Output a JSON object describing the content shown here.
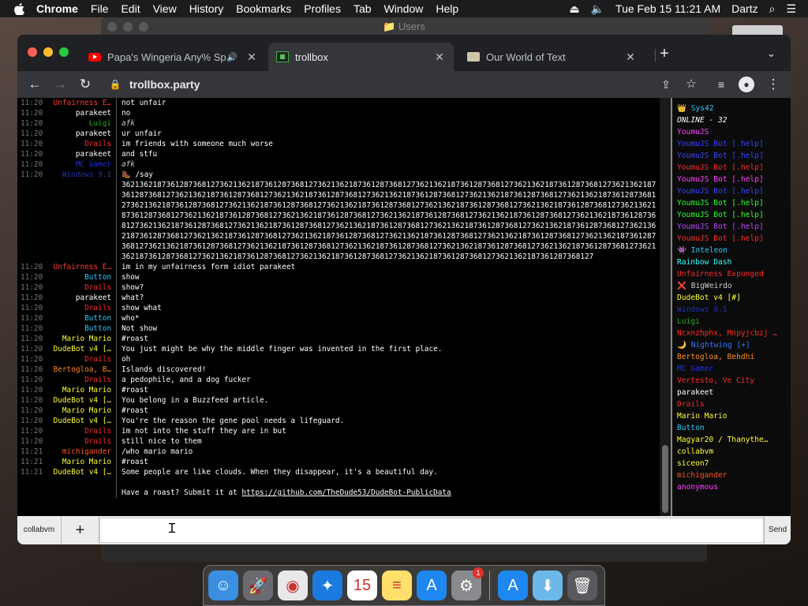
{
  "menubar": {
    "app": "Chrome",
    "items": [
      "File",
      "Edit",
      "View",
      "History",
      "Bookmarks",
      "Profiles",
      "Tab",
      "Window",
      "Help"
    ],
    "datetime": "Tue Feb 15  11:21 AM",
    "user": "Dartz"
  },
  "background_window": {
    "title": "Users"
  },
  "tabs": [
    {
      "title": "Papa's Wingeria Any% Spe",
      "icon": "youtube-icon"
    },
    {
      "title": "trollbox",
      "icon": "trollbox-icon"
    },
    {
      "title": "Our World of Text",
      "icon": "owot-icon"
    }
  ],
  "address": "trollbox.party",
  "chat": [
    {
      "t": "11:20",
      "n": "Unfairness E…",
      "nc": "#ff3b30",
      "m": "not unfair",
      "mc": "#ffffff"
    },
    {
      "t": "11:20",
      "n": "parakeet",
      "nc": "#ffffff",
      "m": "no",
      "mc": "#ffffff"
    },
    {
      "t": "11:20",
      "n": "Luigi",
      "nc": "#22aa22",
      "m": "afk",
      "mc": "#cccccc",
      "it": true
    },
    {
      "t": "11:20",
      "n": "parakeet",
      "nc": "#ffffff",
      "m": "ur unfair",
      "mc": "#ffffff"
    },
    {
      "t": "11:20",
      "n": "Drails",
      "nc": "#ff2a2a",
      "m": "im friends with someone much worse",
      "mc": "#ffffff"
    },
    {
      "t": "11:20",
      "n": "parakeet",
      "nc": "#ffffff",
      "m": "and stfu",
      "mc": "#ffffff"
    },
    {
      "t": "11:20",
      "n": "MC Gamer",
      "nc": "#2233dd",
      "m": "afk",
      "mc": "#cccccc",
      "it": true
    },
    {
      "t": "11:20",
      "n": "Windows 9.1",
      "nc": "#2233aa",
      "m": "🥾 /say",
      "mc": "#ffffff"
    },
    {
      "t": "",
      "n": "",
      "nc": "#ffffff",
      "m": "3621362187361287368127362136218736128736812736213621873612873681273621362187361287368127362136218736128736812736213621873612873681273621362187361287368127362136218736128736812736213621873612873681273621362187361287368127362136218736128736812736213621873612873681273621362187361287368127362136218736128736812736213621873612873681273621362187361287368127362136218736128736812736213621873612873681273621362187361287368127362136218736128736812736213621873612873681273621362187361287368127362136218736128736812736213621873612873681273621362187361287368127362136218736128736812736213621873612873681273621362187361287368127362136218736128736812736213621873612873681273621362187361287368127362136218736128736812736213621873612873681273621362187361287368127362136218736128736812736213621873612873681273621362187361287368127362136218736128736812736213621873612873681273621362187361287368127362136218736128736812736213621873612873681273621362187361287368127",
      "mc": "#ffffff",
      "wrap": true
    },
    {
      "t": "11:20",
      "n": "Unfairness E…",
      "nc": "#ff3b30",
      "m": "im in my unfairness form idiot parakeet",
      "mc": "#ffffff"
    },
    {
      "t": "11:20",
      "n": "Button",
      "nc": "#2ec8ff",
      "m": "show",
      "mc": "#ffffff"
    },
    {
      "t": "11:20",
      "n": "Drails",
      "nc": "#ff2a2a",
      "m": "show?",
      "mc": "#ffffff"
    },
    {
      "t": "11:20",
      "n": "parakeet",
      "nc": "#ffffff",
      "m": "what?",
      "mc": "#ffffff"
    },
    {
      "t": "11:20",
      "n": "Drails",
      "nc": "#ff2a2a",
      "m": "show what",
      "mc": "#ffffff"
    },
    {
      "t": "11:20",
      "n": "Button",
      "nc": "#2ec8ff",
      "m": "who*",
      "mc": "#ffffff"
    },
    {
      "t": "11:20",
      "n": "Button",
      "nc": "#2ec8ff",
      "m": "Not show",
      "mc": "#ffffff"
    },
    {
      "t": "11:20",
      "n": "Mario Mario",
      "nc": "#ffff33",
      "m": "#roast",
      "mc": "#ffffff"
    },
    {
      "t": "11:20",
      "n": "DudeBot v4 […",
      "nc": "#ffff33",
      "m": "You just might be why the middle finger was invented in the first place.",
      "mc": "#ffffff"
    },
    {
      "t": "11:20",
      "n": "Drails",
      "nc": "#ff2a2a",
      "m": "oh",
      "mc": "#ffffff"
    },
    {
      "t": "11:20",
      "n": "Bertogloa, B…",
      "nc": "#ff8c1a",
      "m": "Islands discovered!",
      "mc": "#ffffff"
    },
    {
      "t": "11:20",
      "n": "Drails",
      "nc": "#ff2a2a",
      "m": "a pedophile, and a dog fucker",
      "mc": "#ffffff"
    },
    {
      "t": "11:20",
      "n": "Mario Mario",
      "nc": "#ffff33",
      "m": "#roast",
      "mc": "#ffffff"
    },
    {
      "t": "11:20",
      "n": "DudeBot v4 […",
      "nc": "#ffff33",
      "m": "You belong in a Buzzfeed article.",
      "mc": "#ffffff"
    },
    {
      "t": "11:20",
      "n": "Mario Mario",
      "nc": "#ffff33",
      "m": "#roast",
      "mc": "#ffffff"
    },
    {
      "t": "11:20",
      "n": "DudeBot v4 […",
      "nc": "#ffff33",
      "m": "You're the reason the gene pool needs a lifeguard.",
      "mc": "#ffffff"
    },
    {
      "t": "11:20",
      "n": "Drails",
      "nc": "#ff2a2a",
      "m": "im not into the stuff they are in but",
      "mc": "#ffffff"
    },
    {
      "t": "11:20",
      "n": "Drails",
      "nc": "#ff2a2a",
      "m": "still nice to them",
      "mc": "#ffffff"
    },
    {
      "t": "11:21",
      "n": "michigander",
      "nc": "#ff5522",
      "m": "/who mario mario",
      "mc": "#ffffff"
    },
    {
      "t": "11:21",
      "n": "Mario Mario",
      "nc": "#ffff33",
      "m": "#roast",
      "mc": "#ffffff"
    },
    {
      "t": "11:21",
      "n": "DudeBot v4 […",
      "nc": "#ffff33",
      "m": "Some people are like clouds. When they disappear, it's a beautiful day.",
      "mc": "#ffffff"
    },
    {
      "t": "",
      "n": "",
      "nc": "#ffffff",
      "m": " ",
      "mc": "#ffffff"
    },
    {
      "t": "",
      "n": "",
      "nc": "#ffffff",
      "m": "Have a roast? Submit it at ",
      "mc": "#ffffff",
      "link": "https://github.com/TheDude53/DudeBot-PublicData"
    }
  ],
  "users": [
    {
      "name": "👑 Sys42",
      "c": "#2ec8ff"
    },
    {
      "name": " ",
      "c": "#ffffff"
    },
    {
      "name": "ONLINE - 32",
      "c": "#ffffff",
      "it": true
    },
    {
      "name": "YoumuJS",
      "c": "#ff44ff"
    },
    {
      "name": "YoumuJS Bot [.help]",
      "c": "#3344ff"
    },
    {
      "name": "YoumuJS Bot [.help]",
      "c": "#3344ff"
    },
    {
      "name": "YoumuJS Bot [.help]",
      "c": "#ff2a2a"
    },
    {
      "name": "YoumuJS Bot [.help]",
      "c": "#ff44ff"
    },
    {
      "name": "YoumuJS Bot [.help]",
      "c": "#3344ff"
    },
    {
      "name": "YoumuJS Bot [.help]",
      "c": "#33ff33"
    },
    {
      "name": "YoumuJS Bot [.help]",
      "c": "#33ff33"
    },
    {
      "name": "YoumuJS Bot [.help]",
      "c": "#bb44ff"
    },
    {
      "name": "YoumuJS Bot [.help]",
      "c": "#ff2a2a"
    },
    {
      "name": "👾 Inteleon",
      "c": "#2ec8ff"
    },
    {
      "name": "Rainbow Dash",
      "c": "#33ffff"
    },
    {
      "name": "Unfairness Expunged",
      "c": "#ff2a2a"
    },
    {
      "name": "❌ BigWeirdo",
      "c": "#cccccc"
    },
    {
      "name": "DudeBot v4 [#]",
      "c": "#ffff33"
    },
    {
      "name": "Windows 9.1",
      "c": "#2233aa"
    },
    {
      "name": "Luigi",
      "c": "#22aa22"
    },
    {
      "name": "Ncxnzhphx, Mnpyjcbzj …",
      "c": "#ff2a2a"
    },
    {
      "name": "🌙 Nightwing [+]",
      "c": "#3377ff"
    },
    {
      "name": "Bertogloa, Behdhi",
      "c": "#ff8c1a"
    },
    {
      "name": "MC Gamer",
      "c": "#2233dd"
    },
    {
      "name": "Vertesto, Ve City",
      "c": "#ff2a2a"
    },
    {
      "name": "parakeet",
      "c": "#ffffff"
    },
    {
      "name": "Drails",
      "c": "#ff2a2a"
    },
    {
      "name": "Mario Mario",
      "c": "#ffff33"
    },
    {
      "name": "Button",
      "c": "#2ec8ff"
    },
    {
      "name": "Magyar20 / Thanythe…",
      "c": "#ffff33"
    },
    {
      "name": "collabvm",
      "c": "#ffff33"
    },
    {
      "name": "siceon7",
      "c": "#ffff33"
    },
    {
      "name": "michigander",
      "c": "#ff5522"
    },
    {
      "name": "anonymous",
      "c": "#ff44ff"
    }
  ],
  "input": {
    "room_label": "collabvm",
    "plus": "+",
    "send": "Send",
    "placeholder": ""
  },
  "dock": [
    {
      "name": "finder-icon",
      "bg": "#3a8fe0",
      "glyph": "☺"
    },
    {
      "name": "launchpad-icon",
      "bg": "#6a6a70",
      "glyph": "🚀"
    },
    {
      "name": "chrome-icon",
      "bg": "#e8e8e8",
      "glyph": "◉"
    },
    {
      "name": "safari-icon",
      "bg": "#1a7ae0",
      "glyph": "✦"
    },
    {
      "name": "calendar-icon",
      "bg": "#ffffff",
      "glyph": "15"
    },
    {
      "name": "notes-icon",
      "bg": "#ffe06a",
      "glyph": "≡"
    },
    {
      "name": "app-store-icon",
      "bg": "#1e88f0",
      "glyph": "A"
    },
    {
      "name": "system-preferences-icon",
      "bg": "#8a8a8e",
      "glyph": "⚙",
      "badge": "1"
    },
    {
      "name": "app-store-folder-icon",
      "bg": "#1e88f0",
      "glyph": "A"
    },
    {
      "name": "downloads-folder-icon",
      "bg": "#6cb8e8",
      "glyph": "⬇"
    },
    {
      "name": "trash-icon",
      "bg": "#5a5a5e",
      "glyph": "🗑"
    }
  ]
}
